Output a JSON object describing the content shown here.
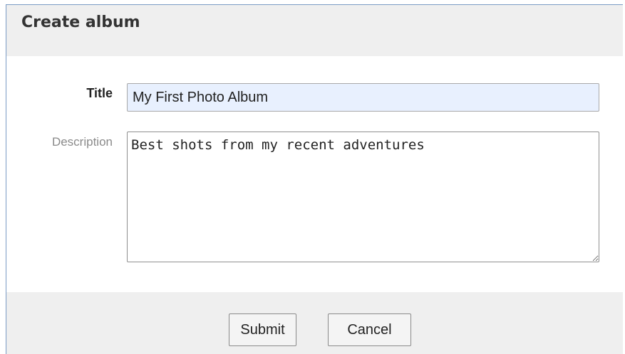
{
  "dialog": {
    "title": "Create album"
  },
  "form": {
    "title_label": "Title",
    "title_value": "My First Photo Album",
    "description_label": "Description",
    "description_value": "Best shots from my recent adventures"
  },
  "footer": {
    "submit_label": "Submit",
    "cancel_label": "Cancel"
  },
  "colors": {
    "header_bg": "#efefef",
    "autofill_bg": "#e8f0fe",
    "border_accent": "#7a9bc4"
  }
}
